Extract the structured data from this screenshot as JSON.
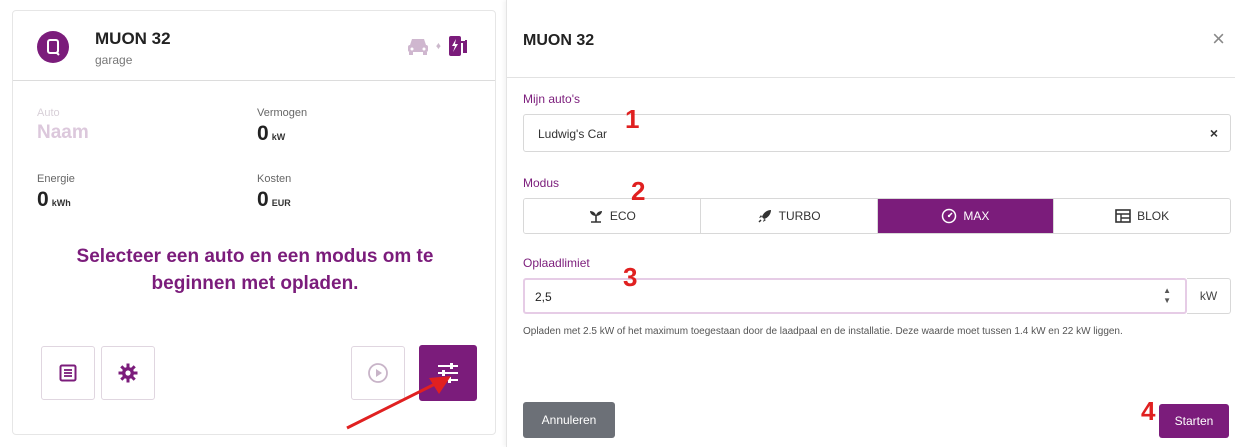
{
  "card": {
    "title": "MUON 32",
    "subtitle": "garage",
    "stats": {
      "auto_label": "Auto",
      "auto_value": "Naam",
      "power_label": "Vermogen",
      "power_value": "0",
      "power_unit": "kW",
      "energy_label": "Energie",
      "energy_value": "0",
      "energy_unit": "kWh",
      "cost_label": "Kosten",
      "cost_value": "0",
      "cost_unit": "EUR"
    },
    "message": "Selecteer een auto en een modus om te beginnen met opladen.",
    "icons": {
      "charger": "charger-icon",
      "car": "car-icon",
      "station": "charging-station-icon",
      "list": "list-icon",
      "settings": "gear-icon",
      "play": "play-icon",
      "sliders": "sliders-icon"
    }
  },
  "dialog": {
    "title": "MUON 32",
    "close": "×",
    "car_label": "Mijn auto's",
    "car_value": "Ludwig's Car",
    "car_clear": "×",
    "mode_label": "Modus",
    "modes": [
      {
        "label": "ECO",
        "icon": "plant-icon",
        "active": false
      },
      {
        "label": "TURBO",
        "icon": "rocket-icon",
        "active": false
      },
      {
        "label": "MAX",
        "icon": "gauge-icon",
        "active": true
      },
      {
        "label": "BLOK",
        "icon": "block-icon",
        "active": false
      }
    ],
    "limit_label": "Oplaadlimiet",
    "limit_value": "2,5",
    "limit_unit": "kW",
    "help_text": "Opladen met 2.5 kW of het maximum toegestaan door de laadpaal en de installatie. Deze waarde moet tussen 1.4 kW en 22 kW liggen.",
    "cancel": "Annuleren",
    "start": "Starten"
  },
  "annotations": [
    "1",
    "2",
    "3",
    "4"
  ],
  "colors": {
    "accent": "#7b1c7b",
    "annotation": "#e02020",
    "cancel": "#6c7077"
  }
}
